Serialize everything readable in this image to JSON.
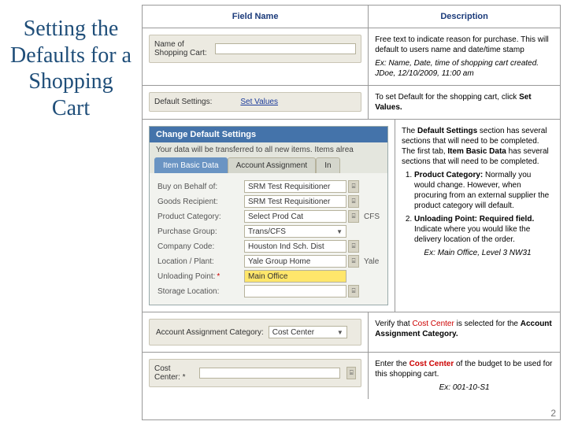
{
  "title": "Setting the Defaults for a Shopping Cart",
  "headers": {
    "field": "Field Name",
    "desc": "Description"
  },
  "row1": {
    "label": "Name of Shopping Cart:",
    "desc1": "Free text to indicate reason for purchase. This will default to users name and date/time stamp",
    "ex": "Ex: Name, Date, time of shopping cart created. JDoe, 12/10/2009, 11:00 am"
  },
  "row2": {
    "label": "Default Settings:",
    "link": "Set Values",
    "desc": "To set Default for the shopping cart, click ",
    "desc_b": "Set Values."
  },
  "row3": {
    "bar": "Change Default Settings",
    "sub": "Your data will be transferred to all new items. Items alrea",
    "tabs": [
      "Item Basic Data",
      "Account Assignment",
      "In"
    ],
    "fields": {
      "behalf": {
        "lbl": "Buy on Behalf of:",
        "val": "SRM Test Requisitioner"
      },
      "goods": {
        "lbl": "Goods Recipient:",
        "val": "SRM Test Requisitioner"
      },
      "prodcat": {
        "lbl": "Product Category:",
        "val": "Select Prod Cat",
        "trail": "CFS"
      },
      "purch": {
        "lbl": "Purchase Group:",
        "val": "Trans/CFS"
      },
      "comp": {
        "lbl": "Company Code:",
        "val": "Houston Ind Sch. Dist"
      },
      "loc": {
        "lbl": "Location / Plant:",
        "val": "Yale Group Home",
        "trail": "Yale"
      },
      "unload": {
        "lbl": "Unloading Point:",
        "val": "Main Office"
      },
      "storage": {
        "lbl": "Storage Location:",
        "val": ""
      }
    },
    "desc_a": "The ",
    "desc_b": "Default Settings",
    "desc_c": " section has several sections that will need to be completed. The first tab, ",
    "desc_d": "Item Basic Data",
    "desc_e": " has several sections that will need to be completed.",
    "li1a": "Product Category:",
    "li1b": " Normally you would change. However, when procuring from an external supplier the product category will default.",
    "li2a": "Unloading Point: Required field.",
    "li2b": " Indicate where you would like the delivery location of the order.",
    "ex2": "Ex: Main Office, Level 3 NW31"
  },
  "row4": {
    "lbl": "Account Assignment Category:",
    "val": "Cost Center",
    "desc_a": "Verify that ",
    "desc_b": "Cost Center",
    "desc_c": " is selected for the ",
    "desc_d": "Account Assignment Category."
  },
  "row5": {
    "lbl": "Cost Center:",
    "desc_a": "Enter the ",
    "desc_b": "Cost Center",
    "desc_c": " of the budget to be used for this shopping cart.",
    "ex": "Ex: 001-10-S1"
  },
  "page_number": "2"
}
